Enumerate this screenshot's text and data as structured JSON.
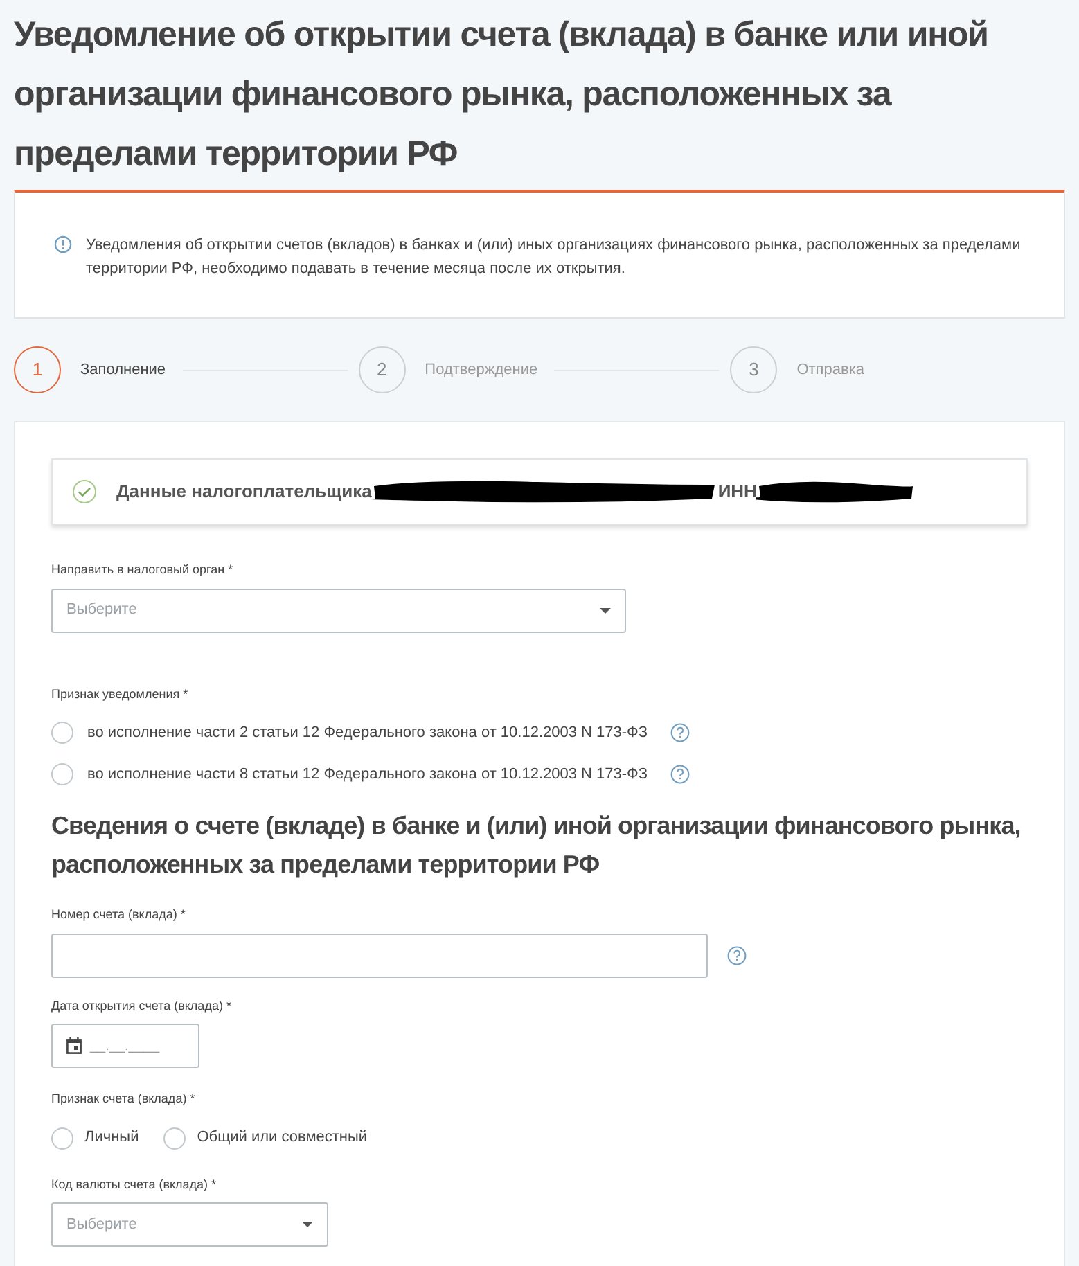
{
  "title": "Уведомление об открытии счета (вклада) в банке или иной организации финансового рынка, расположенных за пределами территории РФ",
  "notice": "Уведомления об открытии счетов (вкладов) в банках и (или) иных организациях финансового рынка, расположенных за пределами территории РФ, необходимо подавать в течение месяца после их открытия.",
  "steps": [
    {
      "number": "1",
      "label": "Заполнение",
      "selected": true
    },
    {
      "number": "2",
      "label": "Подтверждение",
      "selected": false
    },
    {
      "number": "3",
      "label": "Отправка",
      "selected": false
    }
  ],
  "taxpayer": {
    "label": "Данные налогоплательщика",
    "inn_label": "ИНН"
  },
  "tax_office": {
    "label": "Направить в налоговый орган *",
    "placeholder": "Выберите"
  },
  "notice_type": {
    "label": "Признак уведомления *",
    "options": [
      {
        "label": "во исполнение части 2 статьи 12 Федерального закона от 10.12.2003 N 173-ФЗ",
        "checked": false
      },
      {
        "label": "во исполнение части 8 статьи 12 Федерального закона от 10.12.2003 N 173-ФЗ",
        "checked": false
      }
    ]
  },
  "section_title": "Сведения о счете (вкладе) в банке и (или) иной организации финансового рынка, расположенных за пределами территории РФ",
  "account_number": {
    "label": "Номер счета (вклада) *"
  },
  "open_date": {
    "label": "Дата открытия счета (вклада) *",
    "placeholder": "__.__.____"
  },
  "account_type": {
    "label": "Признак счета (вклада) *",
    "options": [
      {
        "label": "Личный",
        "checked": false
      },
      {
        "label": "Общий или совместный",
        "checked": false
      }
    ]
  },
  "currency": {
    "label": "Код валюты счета (вклада) *",
    "placeholder": "Выберите"
  }
}
